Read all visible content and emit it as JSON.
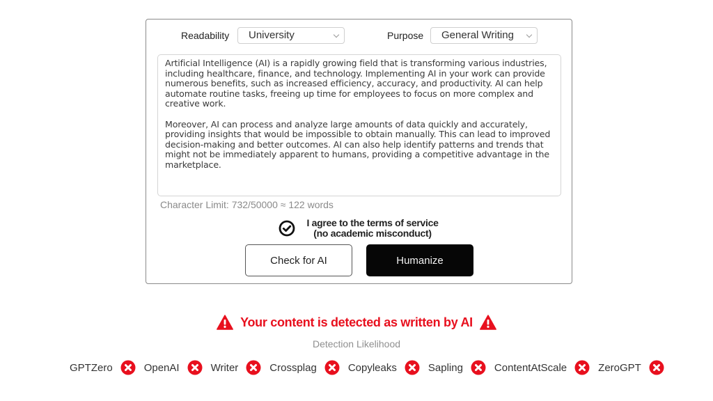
{
  "settings": {
    "readability_label": "Readability",
    "readability_value": "University",
    "purpose_label": "Purpose",
    "purpose_value": "General Writing"
  },
  "editor": {
    "paragraphs": [
      "Artificial Intelligence (AI) is a rapidly growing field that is transforming various industries, including healthcare, finance, and technology. Implementing AI in your work can provide numerous benefits, such as increased efficiency, accuracy, and productivity. AI can help automate routine tasks, freeing up time for employees to focus on more complex and creative work.",
      "Moreover, AI can process and analyze large amounts of data quickly and accurately, providing insights that would be impossible to obtain manually. This can lead to improved decision-making and better outcomes. AI can also help identify patterns and trends that might not be immediately apparent to humans, providing a competitive advantage in the marketplace."
    ],
    "char_limit_text": "Character Limit: 732/50000 ≈ 122 words"
  },
  "agreement": {
    "line1": "I agree to the terms of service",
    "line2": "(no academic misconduct)",
    "checked": true,
    "icon": "check-circle-icon"
  },
  "buttons": {
    "check_label": "Check for AI",
    "humanize_label": "Humanize"
  },
  "result": {
    "alert_text": "Your content is detected as written by AI",
    "alert_icon": "warning-triangle-icon",
    "alert_color": "#e8101e",
    "likelihood_label": "Detection Likelihood"
  },
  "detectors": [
    {
      "name": "GPTZero",
      "status": "fail"
    },
    {
      "name": "OpenAI",
      "status": "fail"
    },
    {
      "name": "Writer",
      "status": "fail"
    },
    {
      "name": "Crossplag",
      "status": "fail"
    },
    {
      "name": "Copyleaks",
      "status": "fail"
    },
    {
      "name": "Sapling",
      "status": "fail"
    },
    {
      "name": "ContentAtScale",
      "status": "fail"
    },
    {
      "name": "ZeroGPT",
      "status": "fail"
    }
  ]
}
